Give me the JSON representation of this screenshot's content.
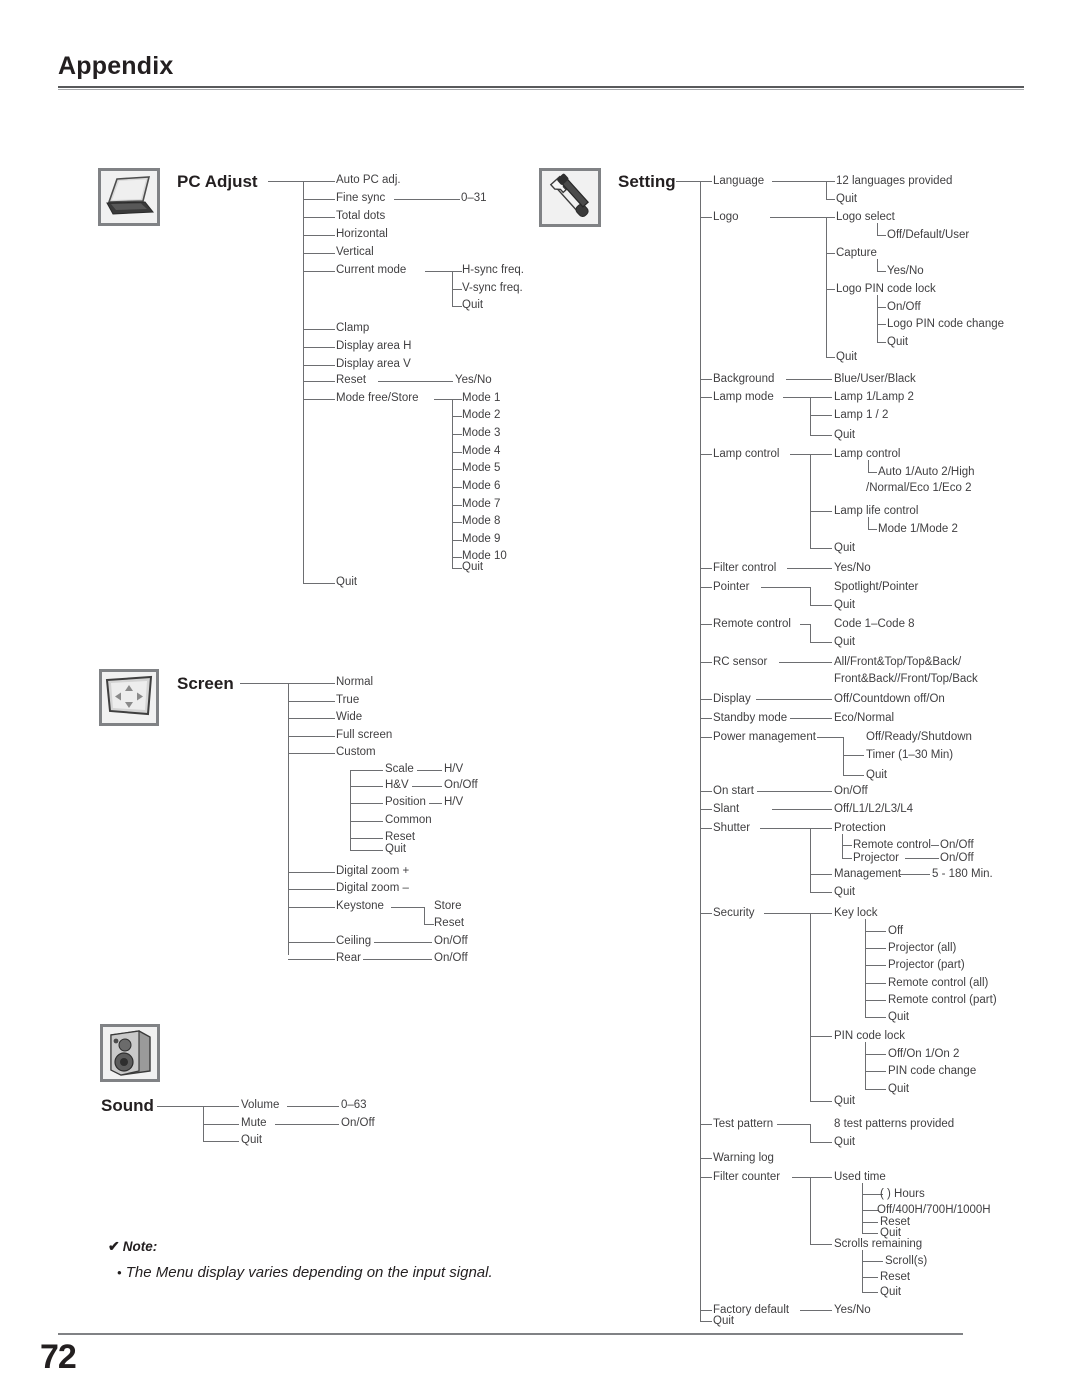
{
  "header": {
    "title": "Appendix"
  },
  "footer": {
    "page_number": "72"
  },
  "note": {
    "check_glyph": "✔",
    "label": "Note:",
    "bullet": "•",
    "text": "The Menu display varies depending on the input signal."
  },
  "sections": {
    "pc_adjust": {
      "title": "PC Adjust",
      "icon": "laptop-icon",
      "items": [
        "Auto PC adj.",
        "Fine sync",
        "0–31",
        "Total dots",
        "Horizontal",
        "Vertical",
        "Current mode",
        "H-sync freq.",
        "V-sync freq.",
        "Quit",
        "Clamp",
        "Display area H",
        "Display area V",
        "Reset",
        "Yes/No",
        "Mode free/Store",
        "Mode 1",
        "Mode 2",
        "Mode 3",
        "Mode 4",
        "Mode 5",
        "Mode 6",
        "Mode 7",
        "Mode 8",
        "Mode 9",
        "Mode 10",
        "Quit",
        "Quit"
      ]
    },
    "screen": {
      "title": "Screen",
      "icon": "screen-arrows-icon",
      "items": [
        "Normal",
        "True",
        "Wide",
        "Full screen",
        "Custom",
        "Scale",
        "H/V",
        "H&V",
        "On/Off",
        "Position",
        "H/V",
        "Common",
        "Reset",
        "Quit",
        "Digital zoom +",
        "Digital zoom –",
        "Keystone",
        "Store",
        "Reset",
        "Ceiling",
        "On/Off",
        "Rear",
        "On/Off"
      ]
    },
    "sound": {
      "title": "Sound",
      "icon": "speaker-icon",
      "items": [
        "Volume",
        "0–63",
        "Mute",
        "On/Off",
        "Quit"
      ]
    },
    "setting": {
      "title": "Setting",
      "icon": "wrench-icon",
      "items": [
        "Language",
        "12 languages provided",
        "Quit",
        "Logo",
        "Logo select",
        "Off/Default/User",
        "Capture",
        "Yes/No",
        "Logo PIN code lock",
        "On/Off",
        "Logo PIN code change",
        "Quit",
        "Quit",
        "Background",
        "Blue/User/Black",
        "Lamp mode",
        "Lamp 1/Lamp 2",
        "Lamp 1 / 2",
        "Quit",
        "Lamp control",
        "Lamp control",
        "Auto 1/Auto 2/High",
        "/Normal/Eco 1/Eco 2",
        "Lamp life control",
        "Mode 1/Mode 2",
        "Quit",
        "Filter control",
        "Yes/No",
        "Pointer",
        "Spotlight/Pointer",
        "Quit",
        "Remote control",
        "Code 1–Code 8",
        "Quit",
        "RC sensor",
        "All/Front&Top/Top&Back/",
        "Front&Back//Front/Top/Back",
        "Display",
        "Off/Countdown off/On",
        "Standby mode",
        "Eco/Normal",
        "Power management",
        "Off/Ready/Shutdown",
        "Timer (1–30 Min)",
        "Quit",
        "On start",
        "On/Off",
        "Slant",
        "Off/L1/L2/L3/L4",
        "Shutter",
        "Protection",
        "Remote control",
        "On/Off",
        "Projector",
        "On/Off",
        "Management",
        "5 - 180 Min.",
        "Quit",
        "Security",
        "Key lock",
        "Off",
        "Projector (all)",
        "Projector (part)",
        "Remote control (all)",
        "Remote control (part)",
        "Quit",
        "PIN code lock",
        "Off/On 1/On 2",
        "PIN code change",
        "Quit",
        "Quit",
        "Test pattern",
        "8 test patterns provided",
        "Quit",
        "Warning log",
        "Filter counter",
        "Used time",
        "(     ) Hours",
        "Off/400H/700H/1000H",
        "Reset",
        "Quit",
        "Scrolls remaining",
        "Scroll(s)",
        "Reset",
        "Quit",
        "Factory default",
        "Yes/No",
        "Quit"
      ]
    }
  },
  "tree": {
    "pc": {
      "auto_pc_adj": "Auto PC adj.",
      "fine_sync": "Fine sync",
      "fine_sync_val": "0–31",
      "total_dots": "Total dots",
      "horizontal": "Horizontal",
      "vertical": "Vertical",
      "current_mode": "Current mode",
      "hsync": "H-sync freq.",
      "vsync": "V-sync freq.",
      "cm_quit": "Quit",
      "clamp": "Clamp",
      "display_area_h": "Display area H",
      "display_area_v": "Display area V",
      "reset": "Reset",
      "reset_val": "Yes/No",
      "mode_free_store": "Mode free/Store",
      "mode1": "Mode 1",
      "mode2": "Mode 2",
      "mode3": "Mode 3",
      "mode4": "Mode 4",
      "mode5": "Mode 5",
      "mode6": "Mode 6",
      "mode7": "Mode 7",
      "mode8": "Mode 8",
      "mode9": "Mode 9",
      "mode10": "Mode 10",
      "mode_quit": "Quit",
      "quit": "Quit"
    },
    "screen": {
      "normal": "Normal",
      "true": "True",
      "wide": "Wide",
      "full_screen": "Full screen",
      "custom": "Custom",
      "scale": "Scale",
      "scale_val": "H/V",
      "hv": "H&V",
      "hv_val": "On/Off",
      "position": "Position",
      "position_val": "H/V",
      "common": "Common",
      "reset": "Reset",
      "custom_quit": "Quit",
      "digital_zoom_plus": "Digital zoom +",
      "digital_zoom_minus": "Digital zoom –",
      "keystone": "Keystone",
      "keystone_store": "Store",
      "keystone_reset": "Reset",
      "ceiling": "Ceiling",
      "ceiling_val": "On/Off",
      "rear": "Rear",
      "rear_val": "On/Off"
    },
    "sound": {
      "volume": "Volume",
      "volume_val": "0–63",
      "mute": "Mute",
      "mute_val": "On/Off",
      "quit": "Quit"
    },
    "setting": {
      "language": "Language",
      "language_val": "12 languages provided",
      "language_quit": "Quit",
      "logo": "Logo",
      "logo_select": "Logo select",
      "logo_select_val": "Off/Default/User",
      "capture": "Capture",
      "capture_val": "Yes/No",
      "logo_pin_lock": "Logo PIN code lock",
      "logo_pin_lock_val": "On/Off",
      "logo_pin_change": "Logo PIN code change",
      "logo_pin_quit": "Quit",
      "logo_quit": "Quit",
      "background": "Background",
      "background_val": "Blue/User/Black",
      "lamp_mode": "Lamp mode",
      "lamp_mode_v1": "Lamp 1/Lamp 2",
      "lamp_mode_v2": "Lamp 1 / 2",
      "lamp_mode_quit": "Quit",
      "lamp_control": "Lamp control",
      "lamp_control_sub": "Lamp control",
      "lamp_control_v1": "Auto 1/Auto 2/High",
      "lamp_control_v2": "/Normal/Eco 1/Eco 2",
      "lamp_life": "Lamp life control",
      "lamp_life_val": "Mode 1/Mode 2",
      "lamp_control_quit": "Quit",
      "filter_control": "Filter control",
      "filter_control_val": "Yes/No",
      "pointer": "Pointer",
      "pointer_val": "Spotlight/Pointer",
      "pointer_quit": "Quit",
      "remote_control": "Remote control",
      "remote_control_val": "Code 1–Code 8",
      "remote_control_quit": "Quit",
      "rc_sensor": "RC sensor",
      "rc_sensor_v1": "All/Front&Top/Top&Back/",
      "rc_sensor_v2": "Front&Back//Front/Top/Back",
      "display": "Display",
      "display_val": "Off/Countdown off/On",
      "standby": "Standby mode",
      "standby_val": "Eco/Normal",
      "power_mgmt": "Power management",
      "power_mgmt_v1": "Off/Ready/Shutdown",
      "power_mgmt_v2": "Timer (1–30 Min)",
      "power_mgmt_quit": "Quit",
      "on_start": "On start",
      "on_start_val": "On/Off",
      "slant": "Slant",
      "slant_val": "Off/L1/L2/L3/L4",
      "shutter": "Shutter",
      "protection": "Protection",
      "prot_remote": "Remote control",
      "prot_remote_val": "On/Off",
      "prot_projector": "Projector",
      "prot_projector_val": "On/Off",
      "management": "Management",
      "management_val": "5 - 180 Min.",
      "shutter_quit": "Quit",
      "security": "Security",
      "key_lock": "Key lock",
      "kl_off": "Off",
      "kl_proj_all": "Projector (all)",
      "kl_proj_part": "Projector (part)",
      "kl_rc_all": "Remote control (all)",
      "kl_rc_part": "Remote control (part)",
      "kl_quit": "Quit",
      "pin_code_lock": "PIN code lock",
      "pin_code_lock_val": "Off/On 1/On 2",
      "pin_code_change": "PIN code change",
      "pin_quit": "Quit",
      "security_quit": "Quit",
      "test_pattern": "Test pattern",
      "test_pattern_val": "8 test patterns provided",
      "test_pattern_quit": "Quit",
      "warning_log": "Warning log",
      "filter_counter": "Filter counter",
      "used_time": "Used time",
      "used_time_hours": "(     ) Hours",
      "used_time_opts": "Off/400H/700H/1000H",
      "used_time_reset": "Reset",
      "used_time_quit": "Quit",
      "scrolls_remaining": "Scrolls remaining",
      "scrolls_val": "Scroll(s)",
      "scrolls_reset": "Reset",
      "scrolls_quit": "Quit",
      "factory_default": "Factory default",
      "factory_default_val": "Yes/No",
      "quit": "Quit"
    }
  }
}
